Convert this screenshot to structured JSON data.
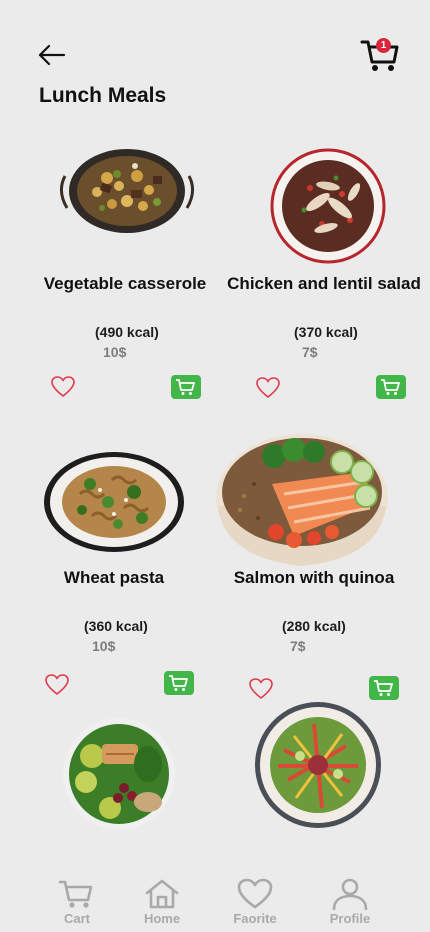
{
  "header": {
    "title": "Lunch Meals",
    "cart_badge": "1"
  },
  "meals": [
    {
      "name": "Vegetable casserole",
      "kcal": "(490 kcal)",
      "price": "10$"
    },
    {
      "name": "Chicken and lentil salad",
      "kcal": "(370 kcal)",
      "price": "7$"
    },
    {
      "name": "Wheat pasta",
      "kcal": "(360 kcal)",
      "price": "10$"
    },
    {
      "name": "Salmon with quinoa",
      "kcal": "(280 kcal)",
      "price": "7$"
    }
  ],
  "nav": {
    "cart": "Cart",
    "home": "Home",
    "favorite": "Faorite",
    "profile": "Profile"
  },
  "colors": {
    "accent_red": "#d9263a",
    "cart_green": "#43b649",
    "nav_gray": "#a9a9a9"
  }
}
